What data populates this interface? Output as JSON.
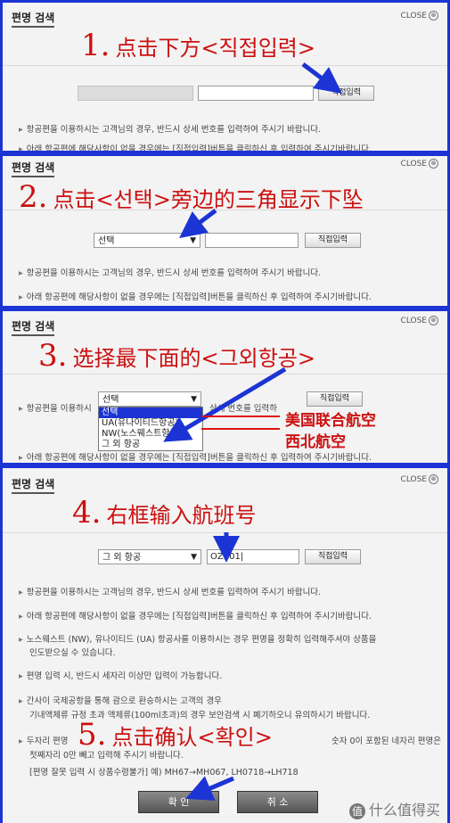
{
  "common": {
    "title": "편명 검색",
    "close": "CLOSE",
    "close_icon": "⊗",
    "direct_input": "직접입력",
    "note1": "항공편을 이용하시는 고객님의 경우, 반드시 상세 번호를 입력하여 주시기 바랍니다.",
    "note2": "아래 항공편에 해당사항이 없을 경우에는 [직접입력]버튼을 클릭하신 후 입력하여 주시기바랍니다.",
    "select_default": "선택",
    "bullet": "▸"
  },
  "panel1": {
    "step_num": "1.",
    "step_text": "点击下方<직접입력>"
  },
  "panel2": {
    "step_num": "2.",
    "step_text": "点击<선택>旁边的三角显示下坠"
  },
  "panel3": {
    "step_num": "3.",
    "step_text": "选择最下面的<그외항공>",
    "options": [
      "선택",
      "UA(유나이티드항공)",
      "NW(노스웨스트항공)",
      "그 외 항공"
    ],
    "note1_partial": "항공편을 이용하시",
    "note1_tail": "상세 번호를 입력하",
    "note2_partial": "아래 항공편에 해당사항이 없을 경우에는 [직접입력]버튼을 클릭하신 후 입력하여 주시기바랍니다.",
    "annot_ua": "美国联合航空",
    "annot_nw": "西北航空"
  },
  "panel4": {
    "step_num": "4.",
    "step_text": "右框输入航班号",
    "select_value": "그 외 항공",
    "flight_value": "OZ301|",
    "notes": [
      "항공편을 이용하시는 고객님의 경우, 반드시 상세 번호를 입력하여 주시기 바랍니다.",
      "아래 항공편에 해당사항이 없을 경우에는 [직접입력]버튼을 클릭하신 후 입력하여 주시기바랍니다.",
      "노스웨스트 (NW), 유나이티드 (UA) 항공사를 이용하시는 경우 편명을 정확히 입력해주셔야 상품을",
      "인도받으실 수 있습니다.",
      "편명 입력 시, 반드시 세자리 이상만 입력이 가능합니다.",
      "간사이 국제공항을 통해 괌으로 환승하시는 고객의 경우",
      "기내액체류 규정 초과 액체류(100ml초과)의 경우 보안검색 시 폐기하오니 유의하시기 바랍니다.",
      "두자리 편명",
      "첫째자리 0만 빼고 입력해 주시기 바랍니다.",
      "[편명 잘못 입력 시 상품수령불가]   예) MH67→MH067, LH0718→LH718"
    ],
    "note_right_tail": "숫자 0이 포함된 네자리 편명은",
    "confirm": "확 인",
    "cancel": "취 소"
  },
  "step5": {
    "step_num": "5.",
    "step_text": "点击确认<확인>"
  },
  "watermark": {
    "icon": "值",
    "text": "什么值得买"
  }
}
